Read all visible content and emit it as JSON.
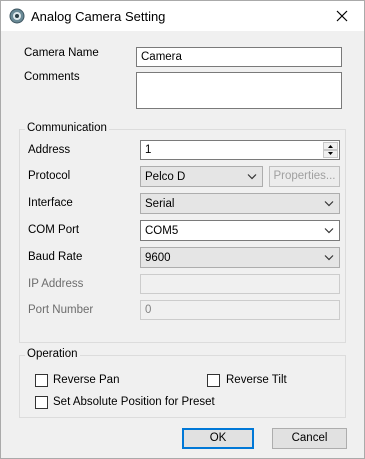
{
  "window": {
    "title": "Analog Camera Setting"
  },
  "fields": {
    "camera_name_label": "Camera Name",
    "camera_name_value": "Camera",
    "comments_label": "Comments",
    "comments_value": ""
  },
  "communication": {
    "group_label": "Communication",
    "address_label": "Address",
    "address_value": "1",
    "protocol_label": "Protocol",
    "protocol_value": "Pelco D",
    "properties_button": "Properties...",
    "interface_label": "Interface",
    "interface_value": "Serial",
    "com_port_label": "COM Port",
    "com_port_value": "COM5",
    "baud_rate_label": "Baud Rate",
    "baud_rate_value": "9600",
    "ip_address_label": "IP Address",
    "ip_address_value": "",
    "port_number_label": "Port Number",
    "port_number_value": "0"
  },
  "operation": {
    "group_label": "Operation",
    "reverse_pan_label": "Reverse Pan",
    "reverse_tilt_label": "Reverse Tilt",
    "absolute_position_label": "Set Absolute Position for Preset",
    "reverse_pan_checked": false,
    "reverse_tilt_checked": false,
    "absolute_position_checked": false
  },
  "buttons": {
    "ok": "OK",
    "cancel": "Cancel"
  },
  "icons": {
    "app": "camera-icon",
    "close": "close-icon",
    "dropdown": "chevron-down-icon",
    "spin_up": "spin-up-icon",
    "spin_down": "spin-down-icon"
  },
  "colors": {
    "accent": "#0078d7",
    "window_bg": "#f0f0f0"
  }
}
